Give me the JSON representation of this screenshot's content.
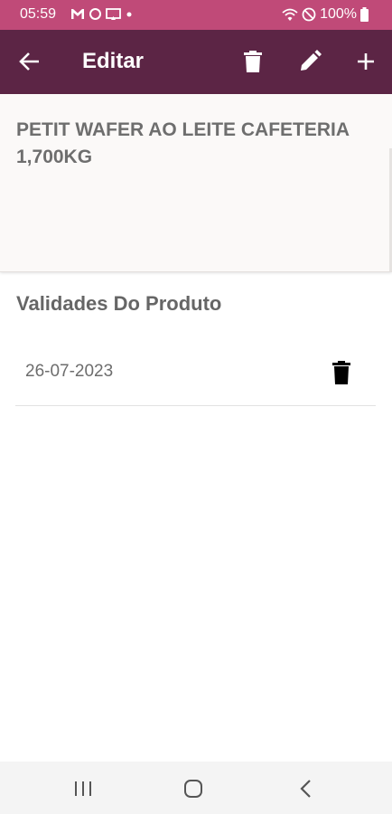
{
  "status_bar": {
    "time": "05:59",
    "battery": "100%",
    "icons": [
      "gmail-icon",
      "circle-icon",
      "cast-icon",
      "dot-icon",
      "wifi-icon",
      "do-not-disturb-icon",
      "battery-icon"
    ]
  },
  "app_bar": {
    "title": "Editar",
    "icons": [
      "back-arrow-icon",
      "trash-icon",
      "pencil-icon",
      "plus-icon"
    ]
  },
  "product": {
    "name": "PETIT WAFER AO LEITE CAFETERIA 1,700KG"
  },
  "validities": {
    "section_title": "Validades Do Produto",
    "items": [
      {
        "date": "26-07-2023"
      }
    ]
  },
  "nav_bar": {
    "icons": [
      "recents-icon",
      "home-icon",
      "back-icon"
    ]
  },
  "colors": {
    "status_bar": "#c04a78",
    "app_bar": "#5c2545",
    "text_gray": "#6e6e6e"
  }
}
